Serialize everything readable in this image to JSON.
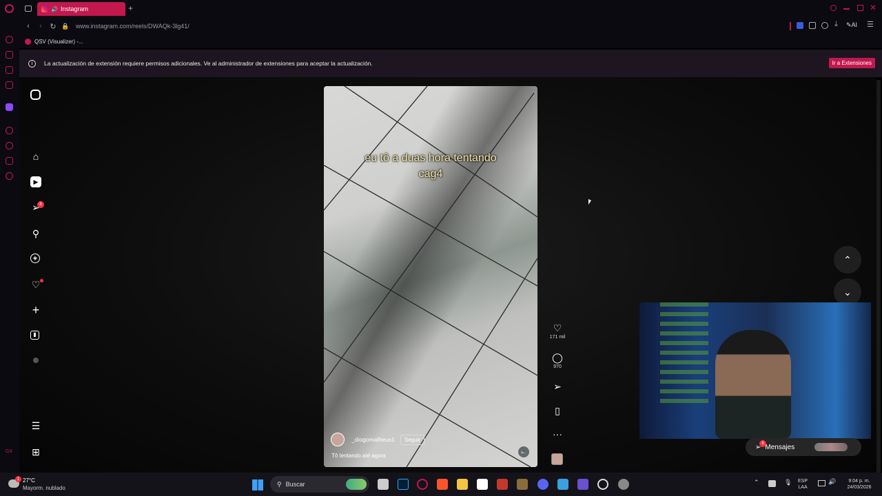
{
  "browser": {
    "tab_title": "Instagram",
    "new_tab_symbol": "+",
    "url": "www.instagram.com/reels/DWAQk-3lg41/",
    "bookmark": "QSV (Visualizer) -...",
    "notice_text": "La actualización de extensión requiere permisos adicionales. Ve al administrador de extensiones para aceptar la actualización.",
    "notice_button": "Ir a Extensiones",
    "ai_label": "AI",
    "accent": "#c2184e"
  },
  "instagram": {
    "notification_badge": "8",
    "reel": {
      "caption_line1": "eu tô a duas hora tentando",
      "caption_line2": "cag4",
      "username": "_diogomatheus1",
      "follow_label": "Seguir",
      "description": "Tô tentando até agora"
    },
    "actions": {
      "likes": "171 mil",
      "comments": "970"
    },
    "messages": {
      "label": "Mensajes",
      "badge": "6"
    }
  },
  "taskbar": {
    "weather_temp": "27°C",
    "weather_desc": "Mayorm. nublado",
    "weather_badge": "1",
    "search_placeholder": "Buscar",
    "lang_line1": "ESP",
    "lang_line2": "LAA",
    "time": "9:04 p. m.",
    "date": "24/03/2026"
  }
}
